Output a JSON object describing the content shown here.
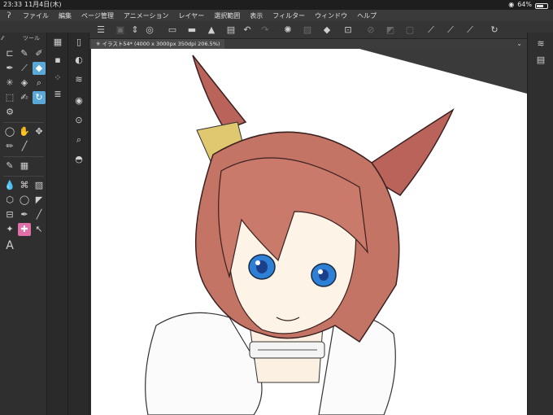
{
  "status": {
    "time": "23:33",
    "date": "11月4日(木)",
    "battery": "64%",
    "battery_level": 0.64
  },
  "menu": {
    "logo": "ʔ",
    "items": [
      "ファイル",
      "編集",
      "ページ管理",
      "アニメーション",
      "レイヤー",
      "選択範囲",
      "表示",
      "フィルター",
      "ウィンドウ",
      "ヘルプ"
    ]
  },
  "commandbar": [
    "menu-icon",
    "new-layer-icon",
    "up-down-icon",
    "eye-icon",
    "new-file-icon",
    "open-folder-icon",
    "save-icon",
    "print-icon",
    "undo-icon",
    "redo-icon",
    "spinner-icon",
    "clear-icon",
    "fill-icon",
    "transform-icon",
    "select-icon",
    "grid-icon",
    "select-all-icon",
    "ruler-icon",
    "brush-size-icon",
    "stroke-icon",
    "smooth-icon",
    "help-icon"
  ],
  "toolbar": {
    "label": "ツール"
  },
  "canvas_tab": {
    "title": "イラスト54* (4000 x 3000px 350dpi 206.5%)"
  },
  "colors": {
    "accent": "#5aa8d8",
    "pink": "#e070a8",
    "bg": "#2b2b2b"
  }
}
